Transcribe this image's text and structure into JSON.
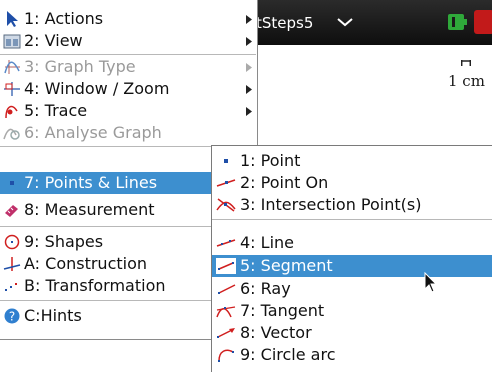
{
  "document": {
    "title": "tSteps5",
    "scale_label": "1 cm"
  },
  "main_menu": {
    "items": [
      {
        "label": "1: Actions",
        "icon": "arrow-cursor-icon",
        "has_submenu": true,
        "enabled": true
      },
      {
        "label": "2: View",
        "icon": "view-icon",
        "has_submenu": true,
        "enabled": true
      },
      {
        "label": "3: Graph Type",
        "icon": "graph-type-icon",
        "has_submenu": true,
        "enabled": false
      },
      {
        "label": "4: Window / Zoom",
        "icon": "window-zoom-icon",
        "has_submenu": true,
        "enabled": true
      },
      {
        "label": "5: Trace",
        "icon": "trace-icon",
        "has_submenu": true,
        "enabled": true
      },
      {
        "label": "6: Analyse Graph",
        "icon": "analyse-graph-icon",
        "has_submenu": true,
        "enabled": false
      },
      {
        "label": "7: Points & Lines",
        "icon": "point-icon",
        "has_submenu": true,
        "enabled": true,
        "active": true
      },
      {
        "label": "8: Measurement",
        "icon": "ruler-icon",
        "has_submenu": true,
        "enabled": true
      },
      {
        "label": "9: Shapes",
        "icon": "shapes-circle-icon",
        "has_submenu": true,
        "enabled": true
      },
      {
        "label": "A: Construction",
        "icon": "construction-icon",
        "has_submenu": true,
        "enabled": true
      },
      {
        "label": "B: Transformation",
        "icon": "transformation-icon",
        "has_submenu": true,
        "enabled": true
      },
      {
        "label": "C:Hints",
        "icon": "help-icon",
        "has_submenu": false,
        "enabled": true
      }
    ]
  },
  "sub_menu": {
    "items": [
      {
        "label": "1: Point",
        "icon": "point-icon"
      },
      {
        "label": "2: Point On",
        "icon": "point-on-icon"
      },
      {
        "label": "3: Intersection Point(s)",
        "icon": "intersection-point-icon"
      },
      {
        "label": "4: Line",
        "icon": "line-icon"
      },
      {
        "label": "5: Segment",
        "icon": "segment-icon",
        "active": true
      },
      {
        "label": "6: Ray",
        "icon": "ray-icon"
      },
      {
        "label": "7: Tangent",
        "icon": "tangent-icon"
      },
      {
        "label": "8: Vector",
        "icon": "vector-icon"
      },
      {
        "label": "9: Circle arc",
        "icon": "circle-arc-icon"
      }
    ]
  },
  "colors": {
    "highlight": "#3d8fcf",
    "disabled_text": "#9a9a9a",
    "title_bar": "#1a1a1a",
    "icon_red": "#d01f1f",
    "icon_blue": "#1f4fa8"
  }
}
